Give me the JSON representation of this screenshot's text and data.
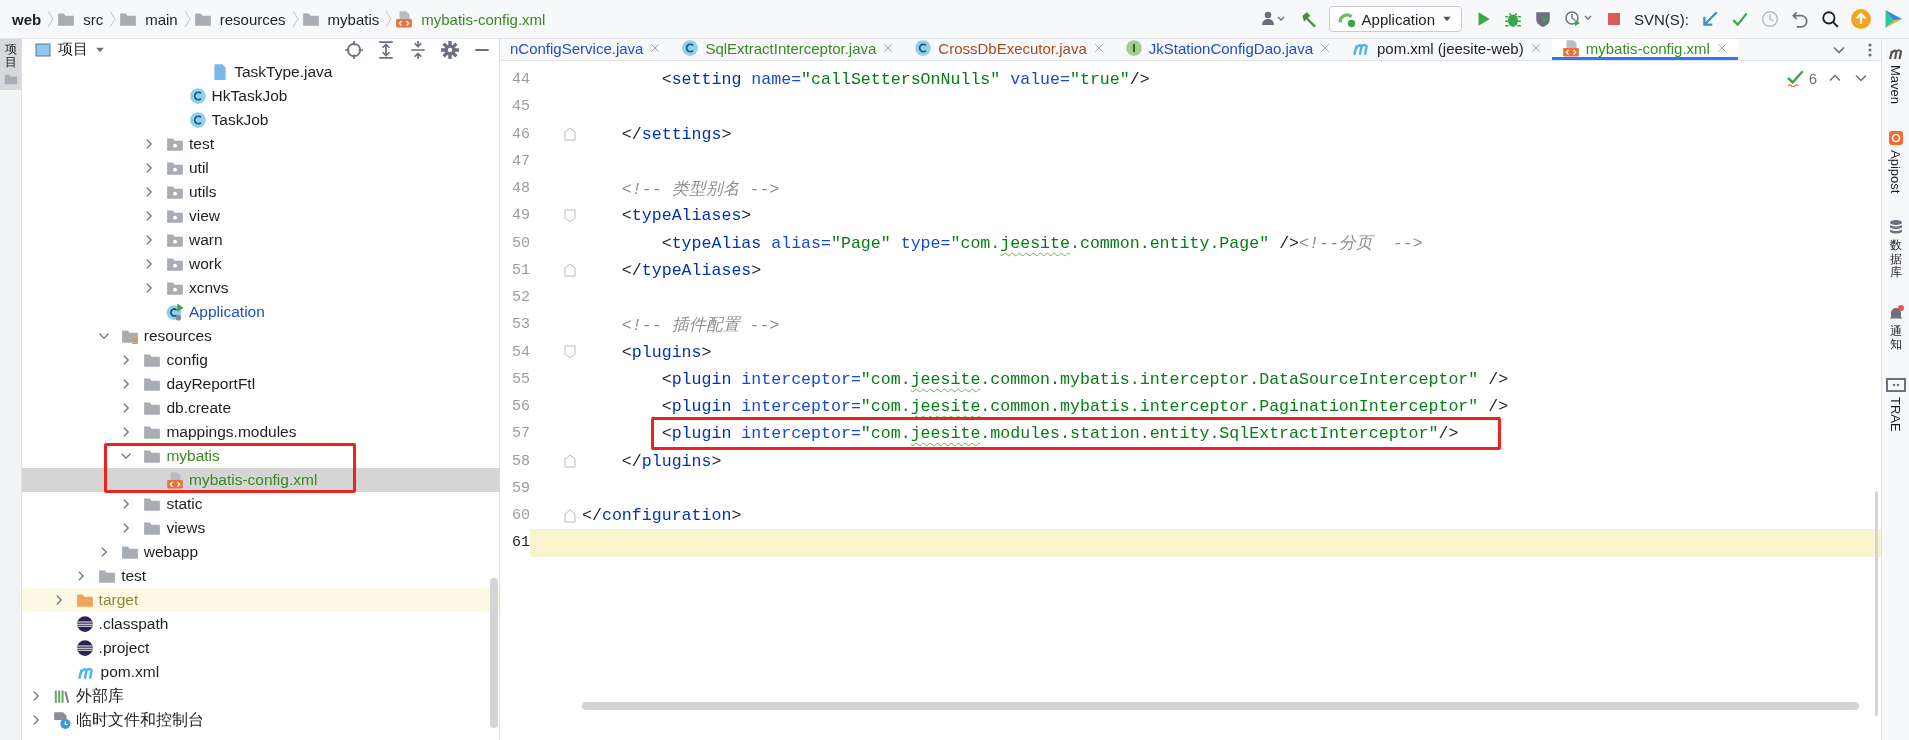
{
  "breadcrumbs": [
    {
      "label": "web",
      "kind": "module"
    },
    {
      "label": "src",
      "kind": "folder"
    },
    {
      "label": "main",
      "kind": "folder"
    },
    {
      "label": "resources",
      "kind": "folder"
    },
    {
      "label": "mybatis",
      "kind": "folder"
    },
    {
      "label": "mybatis-config.xml",
      "kind": "xml-file",
      "color": "#3a8a23"
    }
  ],
  "toolbar": {
    "run_configuration": "Application",
    "vcs_label": "SVN(S):"
  },
  "left_strip": [
    {
      "label": "项目",
      "selected": true
    }
  ],
  "project_panel": {
    "title": "项目",
    "tree": [
      {
        "children": [
          {
            "children": [
              {
                "children": [
                  {
                    "children": [
                      {
                        "children": [
                          {
                            "children": [
                              {
                                "children": [
                                  {
                                    "label": "TaskType.java",
                                    "kind": "java-file",
                                    "selected": false
                                  }
                                ]
                              },
                              {
                                "label": "HkTaskJob",
                                "kind": "class",
                                "selected": false
                              },
                              {
                                "label": "TaskJob",
                                "kind": "class",
                                "selected": false
                              }
                            ]
                          },
                          {
                            "label": "test",
                            "kind": "package",
                            "expanded": false,
                            "selected": false
                          },
                          {
                            "label": "util",
                            "kind": "package",
                            "expanded": false,
                            "selected": false
                          },
                          {
                            "label": "utils",
                            "kind": "package",
                            "expanded": false,
                            "selected": false
                          },
                          {
                            "label": "view",
                            "kind": "package",
                            "expanded": false,
                            "selected": false
                          },
                          {
                            "label": "warn",
                            "kind": "package",
                            "expanded": false,
                            "selected": false
                          },
                          {
                            "label": "work",
                            "kind": "package",
                            "expanded": false,
                            "selected": false
                          },
                          {
                            "label": "xcnvs",
                            "kind": "package",
                            "expanded": false,
                            "selected": false
                          },
                          {
                            "label": "Application",
                            "kind": "app-class",
                            "color": "#1f4fc4",
                            "selected": false
                          }
                        ]
                      }
                    ]
                  },
                  {
                    "label": "resources",
                    "kind": "resources-folder",
                    "expanded": true,
                    "selected": false,
                    "children": [
                      {
                        "label": "config",
                        "kind": "folder",
                        "expanded": false,
                        "selected": false
                      },
                      {
                        "label": "dayReportFtl",
                        "kind": "folder",
                        "expanded": false,
                        "selected": false
                      },
                      {
                        "label": "db.create",
                        "kind": "folder",
                        "expanded": false,
                        "selected": false
                      },
                      {
                        "label": "mappings.modules",
                        "kind": "folder",
                        "expanded": false,
                        "selected": false
                      },
                      {
                        "label": "mybatis",
                        "kind": "folder",
                        "color": "#3a8a23",
                        "expanded": true,
                        "selected": false,
                        "children": [
                          {
                            "label": "mybatis-config.xml",
                            "kind": "xml-file",
                            "color": "#3a8a23",
                            "selected": true
                          }
                        ]
                      },
                      {
                        "label": "static",
                        "kind": "folder",
                        "expanded": false,
                        "selected": false
                      },
                      {
                        "label": "views",
                        "kind": "folder",
                        "expanded": false,
                        "selected": false
                      }
                    ]
                  },
                  {
                    "label": "webapp",
                    "kind": "folder",
                    "expanded": false,
                    "selected": false
                  }
                ]
              },
              {
                "label": "test",
                "kind": "folder",
                "expanded": false,
                "selected": false
              }
            ]
          },
          {
            "label": "target",
            "kind": "excluded-folder",
            "color": "#8a8a3a",
            "expanded": false,
            "selected": false
          },
          {
            "label": ".classpath",
            "kind": "eclipse-file",
            "selected": false
          },
          {
            "label": ".project",
            "kind": "eclipse-file",
            "selected": false
          },
          {
            "label": "pom.xml",
            "kind": "maven-file",
            "selected": false
          }
        ]
      },
      {
        "label": "外部库",
        "kind": "library",
        "expanded": false,
        "selected": false
      },
      {
        "label": "临时文件和控制台",
        "kind": "scratches",
        "expanded": false,
        "selected": false
      }
    ]
  },
  "editor": {
    "tabs": [
      {
        "label": "nConfigService.java",
        "color": "#1f4fc4",
        "selected": false
      },
      {
        "label": "SqlExtractInterceptor.java",
        "kind": "class",
        "color": "#3a8a23",
        "selected": false
      },
      {
        "label": "CrossDbExecutor.java",
        "kind": "class",
        "color": "#a64a1e",
        "selected": false
      },
      {
        "label": "JkStationConfigDao.java",
        "kind": "interface",
        "color": "#1f4fc4",
        "selected": false
      },
      {
        "label": "pom.xml (jeesite-web)",
        "kind": "maven-file",
        "selected": false
      },
      {
        "label": "mybatis-config.xml",
        "kind": "xml-file",
        "color": "#3a8a23",
        "selected": true
      }
    ],
    "inspection_count": "6",
    "lines": [
      {
        "number": "44",
        "current": false,
        "tokens": [
          {
            "kind": "bracket",
            "text": "        <"
          },
          {
            "kind": "tag",
            "text": "setting"
          },
          {
            "kind": "attr",
            "text": " name="
          },
          {
            "kind": "value",
            "text": "\"callSettersOnNulls\""
          },
          {
            "kind": "attr",
            "text": " value="
          },
          {
            "kind": "value",
            "text": "\"true\""
          },
          {
            "kind": "bracket",
            "text": "/>"
          }
        ]
      },
      {
        "number": "45",
        "current": false
      },
      {
        "number": "46",
        "current": false,
        "kind": "fold-end",
        "tokens": [
          {
            "kind": "bracket",
            "text": "    </"
          },
          {
            "kind": "tag",
            "text": "settings"
          },
          {
            "kind": "bracket",
            "text": ">"
          }
        ]
      },
      {
        "number": "47",
        "current": false
      },
      {
        "number": "48",
        "current": false,
        "tokens": [
          {
            "kind": "comment",
            "text": "    <!-- 类型别名 -->"
          }
        ]
      },
      {
        "number": "49",
        "current": false,
        "kind": "fold-start",
        "tokens": [
          {
            "kind": "bracket",
            "text": "    <"
          },
          {
            "kind": "tag",
            "text": "typeAliases"
          },
          {
            "kind": "bracket",
            "text": ">"
          }
        ]
      },
      {
        "number": "50",
        "current": false,
        "tokens": [
          {
            "kind": "bracket",
            "text": "        <"
          },
          {
            "kind": "tag",
            "text": "typeAlias"
          },
          {
            "kind": "attr",
            "text": " alias="
          },
          {
            "kind": "value",
            "text": "\"Page\""
          },
          {
            "kind": "attr",
            "text": " type="
          },
          {
            "kind": "value",
            "text": "\"com."
          },
          {
            "kind": "value",
            "text": "jeesite",
            "typo": true
          },
          {
            "kind": "value",
            "text": ".common.entity.Page\""
          },
          {
            "kind": "bracket",
            "text": " />"
          },
          {
            "kind": "comment",
            "text": "<!--分页  -->"
          }
        ]
      },
      {
        "number": "51",
        "current": false,
        "kind": "fold-end",
        "tokens": [
          {
            "kind": "bracket",
            "text": "    </"
          },
          {
            "kind": "tag",
            "text": "typeAliases"
          },
          {
            "kind": "bracket",
            "text": ">"
          }
        ]
      },
      {
        "number": "52",
        "current": false
      },
      {
        "number": "53",
        "current": false,
        "tokens": [
          {
            "kind": "comment",
            "text": "    <!-- 插件配置 -->"
          }
        ]
      },
      {
        "number": "54",
        "current": false,
        "kind": "fold-start",
        "tokens": [
          {
            "kind": "bracket",
            "text": "    <"
          },
          {
            "kind": "tag",
            "text": "plugins"
          },
          {
            "kind": "bracket",
            "text": ">"
          }
        ]
      },
      {
        "number": "55",
        "current": false,
        "tokens": [
          {
            "kind": "bracket",
            "text": "        <"
          },
          {
            "kind": "tag",
            "text": "plugin"
          },
          {
            "kind": "attr",
            "text": " interceptor="
          },
          {
            "kind": "value",
            "text": "\"com."
          },
          {
            "kind": "value",
            "text": "jeesite",
            "typo": true
          },
          {
            "kind": "value",
            "text": ".common.mybatis.interceptor.DataSourceInterceptor\""
          },
          {
            "kind": "bracket",
            "text": " />"
          }
        ]
      },
      {
        "number": "56",
        "current": false,
        "tokens": [
          {
            "kind": "bracket",
            "text": "        <"
          },
          {
            "kind": "tag",
            "text": "plugin"
          },
          {
            "kind": "attr",
            "text": " interceptor="
          },
          {
            "kind": "value",
            "text": "\"com."
          },
          {
            "kind": "value",
            "text": "jeesite",
            "typo": true
          },
          {
            "kind": "value",
            "text": ".common.mybatis.interceptor.PaginationInterceptor\""
          },
          {
            "kind": "bracket",
            "text": " />"
          }
        ]
      },
      {
        "number": "57",
        "current": false,
        "annotated": true,
        "tokens": [
          {
            "kind": "bracket",
            "text": "        <"
          },
          {
            "kind": "tag",
            "text": "plugin"
          },
          {
            "kind": "attr",
            "text": " interceptor="
          },
          {
            "kind": "value",
            "text": "\"com."
          },
          {
            "kind": "value",
            "text": "jeesite",
            "typo": true
          },
          {
            "kind": "value",
            "text": ".modules.station.entity.SqlExtractInterceptor\""
          },
          {
            "kind": "bracket",
            "text": "/>"
          }
        ]
      },
      {
        "number": "58",
        "current": false,
        "kind": "fold-end",
        "tokens": [
          {
            "kind": "bracket",
            "text": "    </"
          },
          {
            "kind": "tag",
            "text": "plugins"
          },
          {
            "kind": "bracket",
            "text": ">"
          }
        ]
      },
      {
        "number": "59",
        "current": false
      },
      {
        "number": "60",
        "current": false,
        "kind": "fold-end",
        "tokens": [
          {
            "kind": "bracket",
            "text": "</"
          },
          {
            "kind": "tag",
            "text": "configuration"
          },
          {
            "kind": "bracket",
            "text": ">"
          }
        ]
      },
      {
        "number": "61",
        "current": true
      }
    ]
  },
  "right_strip": [
    {
      "label": "Maven",
      "kind": "maven",
      "unread": false
    },
    {
      "label": "Apipost",
      "kind": "apipost",
      "unread": false
    },
    {
      "label": "数据库",
      "kind": "database",
      "unread": false
    },
    {
      "label": "通知",
      "kind": "notifications",
      "unread": true
    },
    {
      "label": "TRAE",
      "kind": "trae",
      "unread": false
    }
  ]
}
